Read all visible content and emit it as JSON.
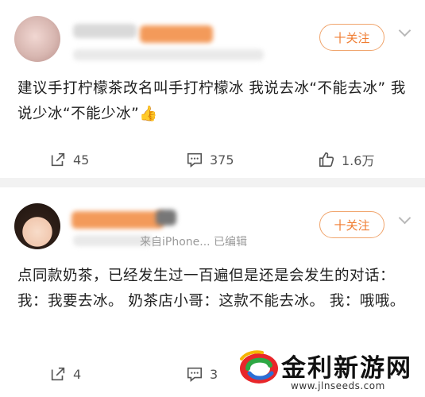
{
  "posts": [
    {
      "follow_label": "十关注",
      "meta": "",
      "content": "建议手打柠檬茶改名叫手打柠檬冰 我说去冰“不能去冰” 我说少冰“不能少冰”👍",
      "actions": {
        "repost": "45",
        "comment": "375",
        "like": "1.6万"
      }
    },
    {
      "follow_label": "十关注",
      "meta": "来自iPhone...  已编辑",
      "content": "点同款奶茶，已经发生过一百遍但是还是会发生的对话：  我：我要去冰。  奶茶店小哥：这款不能去冰。  我：哦哦。",
      "actions": {
        "repost": "4",
        "comment": "3"
      }
    }
  ],
  "watermark": {
    "brand": "金利新游网",
    "url": "www.jlnseeds.com"
  },
  "icons": [
    "share-icon",
    "comment-icon",
    "like-icon",
    "chevron-down-icon",
    "brand-logo-icon"
  ],
  "colors": {
    "accent": "#f07d32",
    "follow_border": "#f0a56d",
    "separator": "#f2f2f2"
  }
}
